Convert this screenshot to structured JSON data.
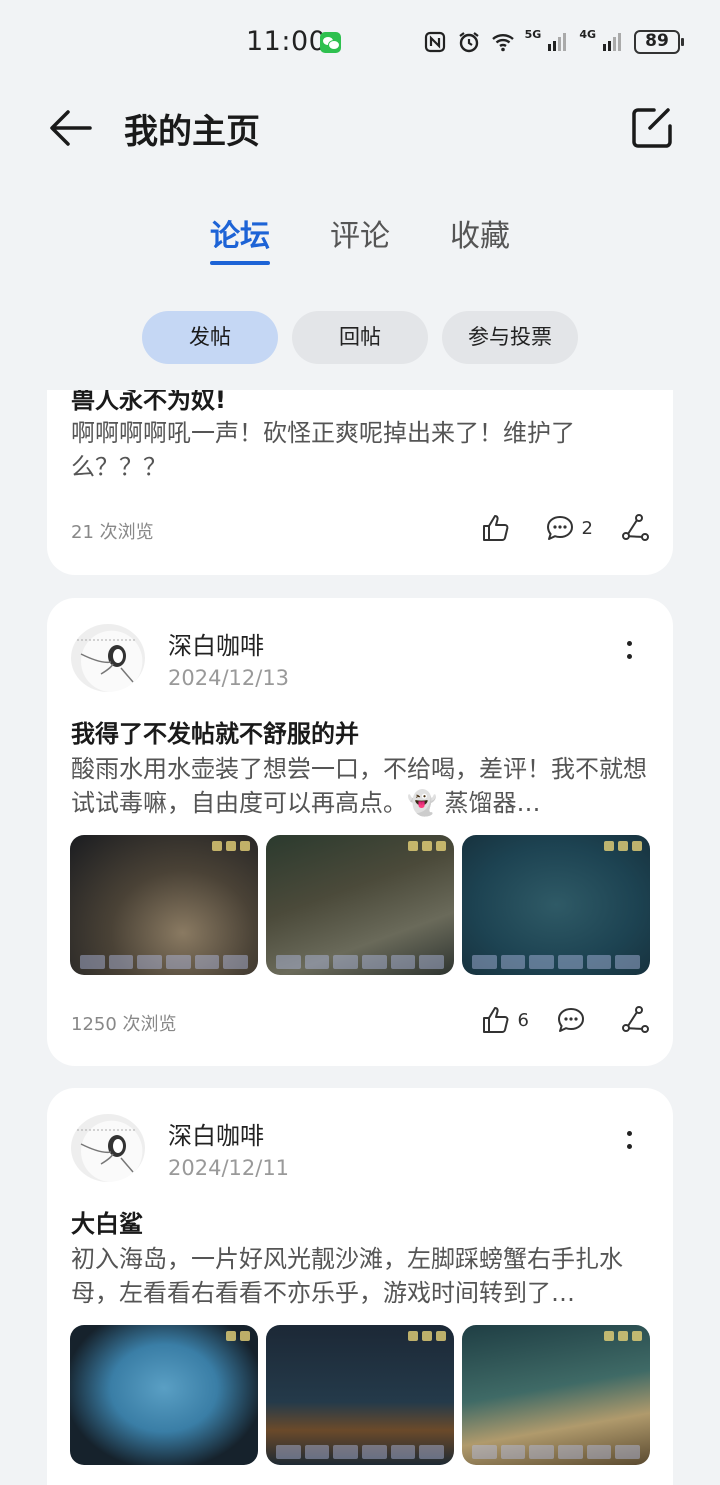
{
  "status": {
    "time": "11:00",
    "battery": "89",
    "sig5g": "5G",
    "sig4g": "4G"
  },
  "header": {
    "title": "我的主页"
  },
  "tabs": [
    {
      "label": "论坛",
      "active": true
    },
    {
      "label": "评论",
      "active": false
    },
    {
      "label": "收藏",
      "active": false
    }
  ],
  "subtabs": [
    {
      "label": "发帖",
      "active": true
    },
    {
      "label": "回帖",
      "active": false
    },
    {
      "label": "参与投票",
      "active": false
    }
  ],
  "posts": [
    {
      "title": "兽人永不为奴!",
      "excerpt": "啊啊啊啊吼一声！砍怪正爽呢掉出来了！维护了么？？？",
      "views": "21 次浏览",
      "likes": "",
      "comments": "2"
    },
    {
      "author": "深白咖啡",
      "date": "2024/12/13",
      "title": "我得了不发帖就不舒服的并",
      "excerpt": "酸雨水用水壶装了想尝一口，不给喝，差评！我不就想试试毒嘛，自由度可以再高点。👻 蒸馏器…",
      "views": "1250 次浏览",
      "likes": "6",
      "comments": ""
    },
    {
      "author": "深白咖啡",
      "date": "2024/12/11",
      "title": "大白鲨",
      "excerpt": "初入海岛，一片好风光靓沙滩，左脚踩螃蟹右手扎水母，左看看右看看不亦乐乎，游戏时间转到了…",
      "views": "",
      "likes": "",
      "comments": ""
    }
  ],
  "colors": {
    "accent": "#1d63d6",
    "background": "#f1f3f5",
    "subtab_active": "#c5d7f4"
  }
}
